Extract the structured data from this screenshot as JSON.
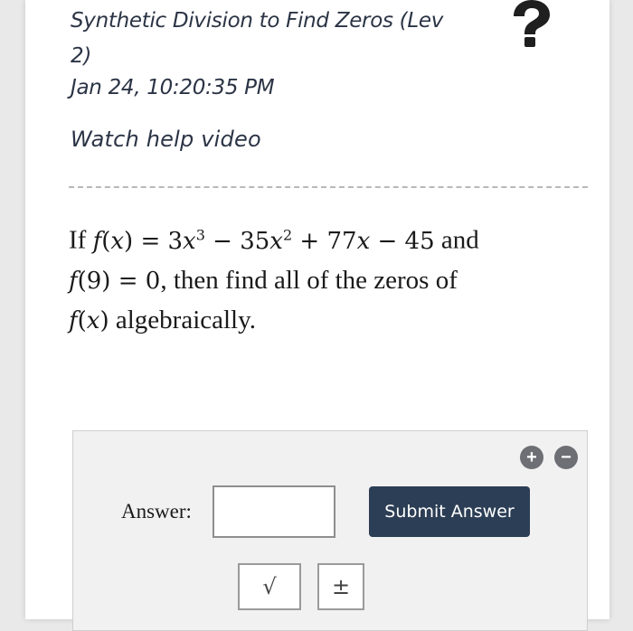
{
  "header": {
    "title": "Synthetic Division to Find Zeros (Lev 2)",
    "timestamp": "Jan 24, 10:20:35 PM",
    "help_link": "Watch help video",
    "help_icon": "question-mark-icon"
  },
  "question": {
    "prefix": "If",
    "function_definition": "f(x) = 3x^3 − 35x^2 + 77x − 45",
    "connector1": "and",
    "given": "f(9) = 0",
    "middle_text": ", then find all of the zeros of",
    "target": "f(x)",
    "suffix": "algebraically."
  },
  "answer_panel": {
    "add_icon": "plus-circle-icon",
    "remove_icon": "minus-circle-icon",
    "label": "Answer:",
    "input_value": "",
    "submit_label": "Submit Answer",
    "tools": [
      {
        "label": "√",
        "name": "square-root"
      },
      {
        "label": "±",
        "name": "plus-minus"
      }
    ]
  },
  "colors": {
    "submit_bg": "#2c3e55",
    "text": "#2b3445",
    "panel_bg": "#f1f1f1"
  }
}
